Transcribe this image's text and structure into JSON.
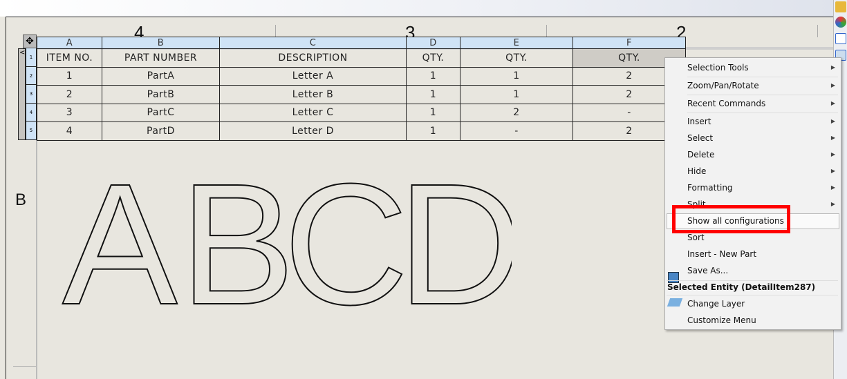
{
  "zones": {
    "top": [
      "4",
      "3",
      "2"
    ],
    "left": "B"
  },
  "table": {
    "col_letters": [
      "A",
      "B",
      "C",
      "D",
      "E",
      "F"
    ],
    "row_numbers": [
      "1",
      "2",
      "3",
      "4",
      "5"
    ],
    "header": [
      "ITEM NO.",
      "PART NUMBER",
      "DESCRIPTION",
      "QTY.",
      "QTY.",
      "QTY."
    ],
    "rows": [
      [
        "1",
        "PartA",
        "Letter A",
        "1",
        "1",
        "2"
      ],
      [
        "2",
        "PartB",
        "Letter B",
        "1",
        "1",
        "2"
      ],
      [
        "3",
        "PartC",
        "Letter C",
        "1",
        "2",
        "-"
      ],
      [
        "4",
        "PartD",
        "Letter D",
        "1",
        "-",
        "2"
      ]
    ]
  },
  "drawing": {
    "letters": [
      "A",
      "B",
      "C",
      "D"
    ]
  },
  "context_menu": {
    "items": [
      "Selection Tools",
      "Zoom/Pan/Rotate",
      "Recent Commands",
      "Insert",
      "Select",
      "Delete",
      "Hide",
      "Formatting",
      "Split",
      "Show all configurations",
      "Sort",
      "Insert - New Part",
      "Save As..."
    ],
    "section_title": "Selected Entity (DetailItem287)",
    "section_items": [
      "Change Layer",
      "Customize Menu"
    ],
    "highlighted": "Show all configurations"
  },
  "colors": {
    "highlight_box": "#ff0000",
    "column_header": "#cfe3f6",
    "sheet": "#e8e6df"
  }
}
